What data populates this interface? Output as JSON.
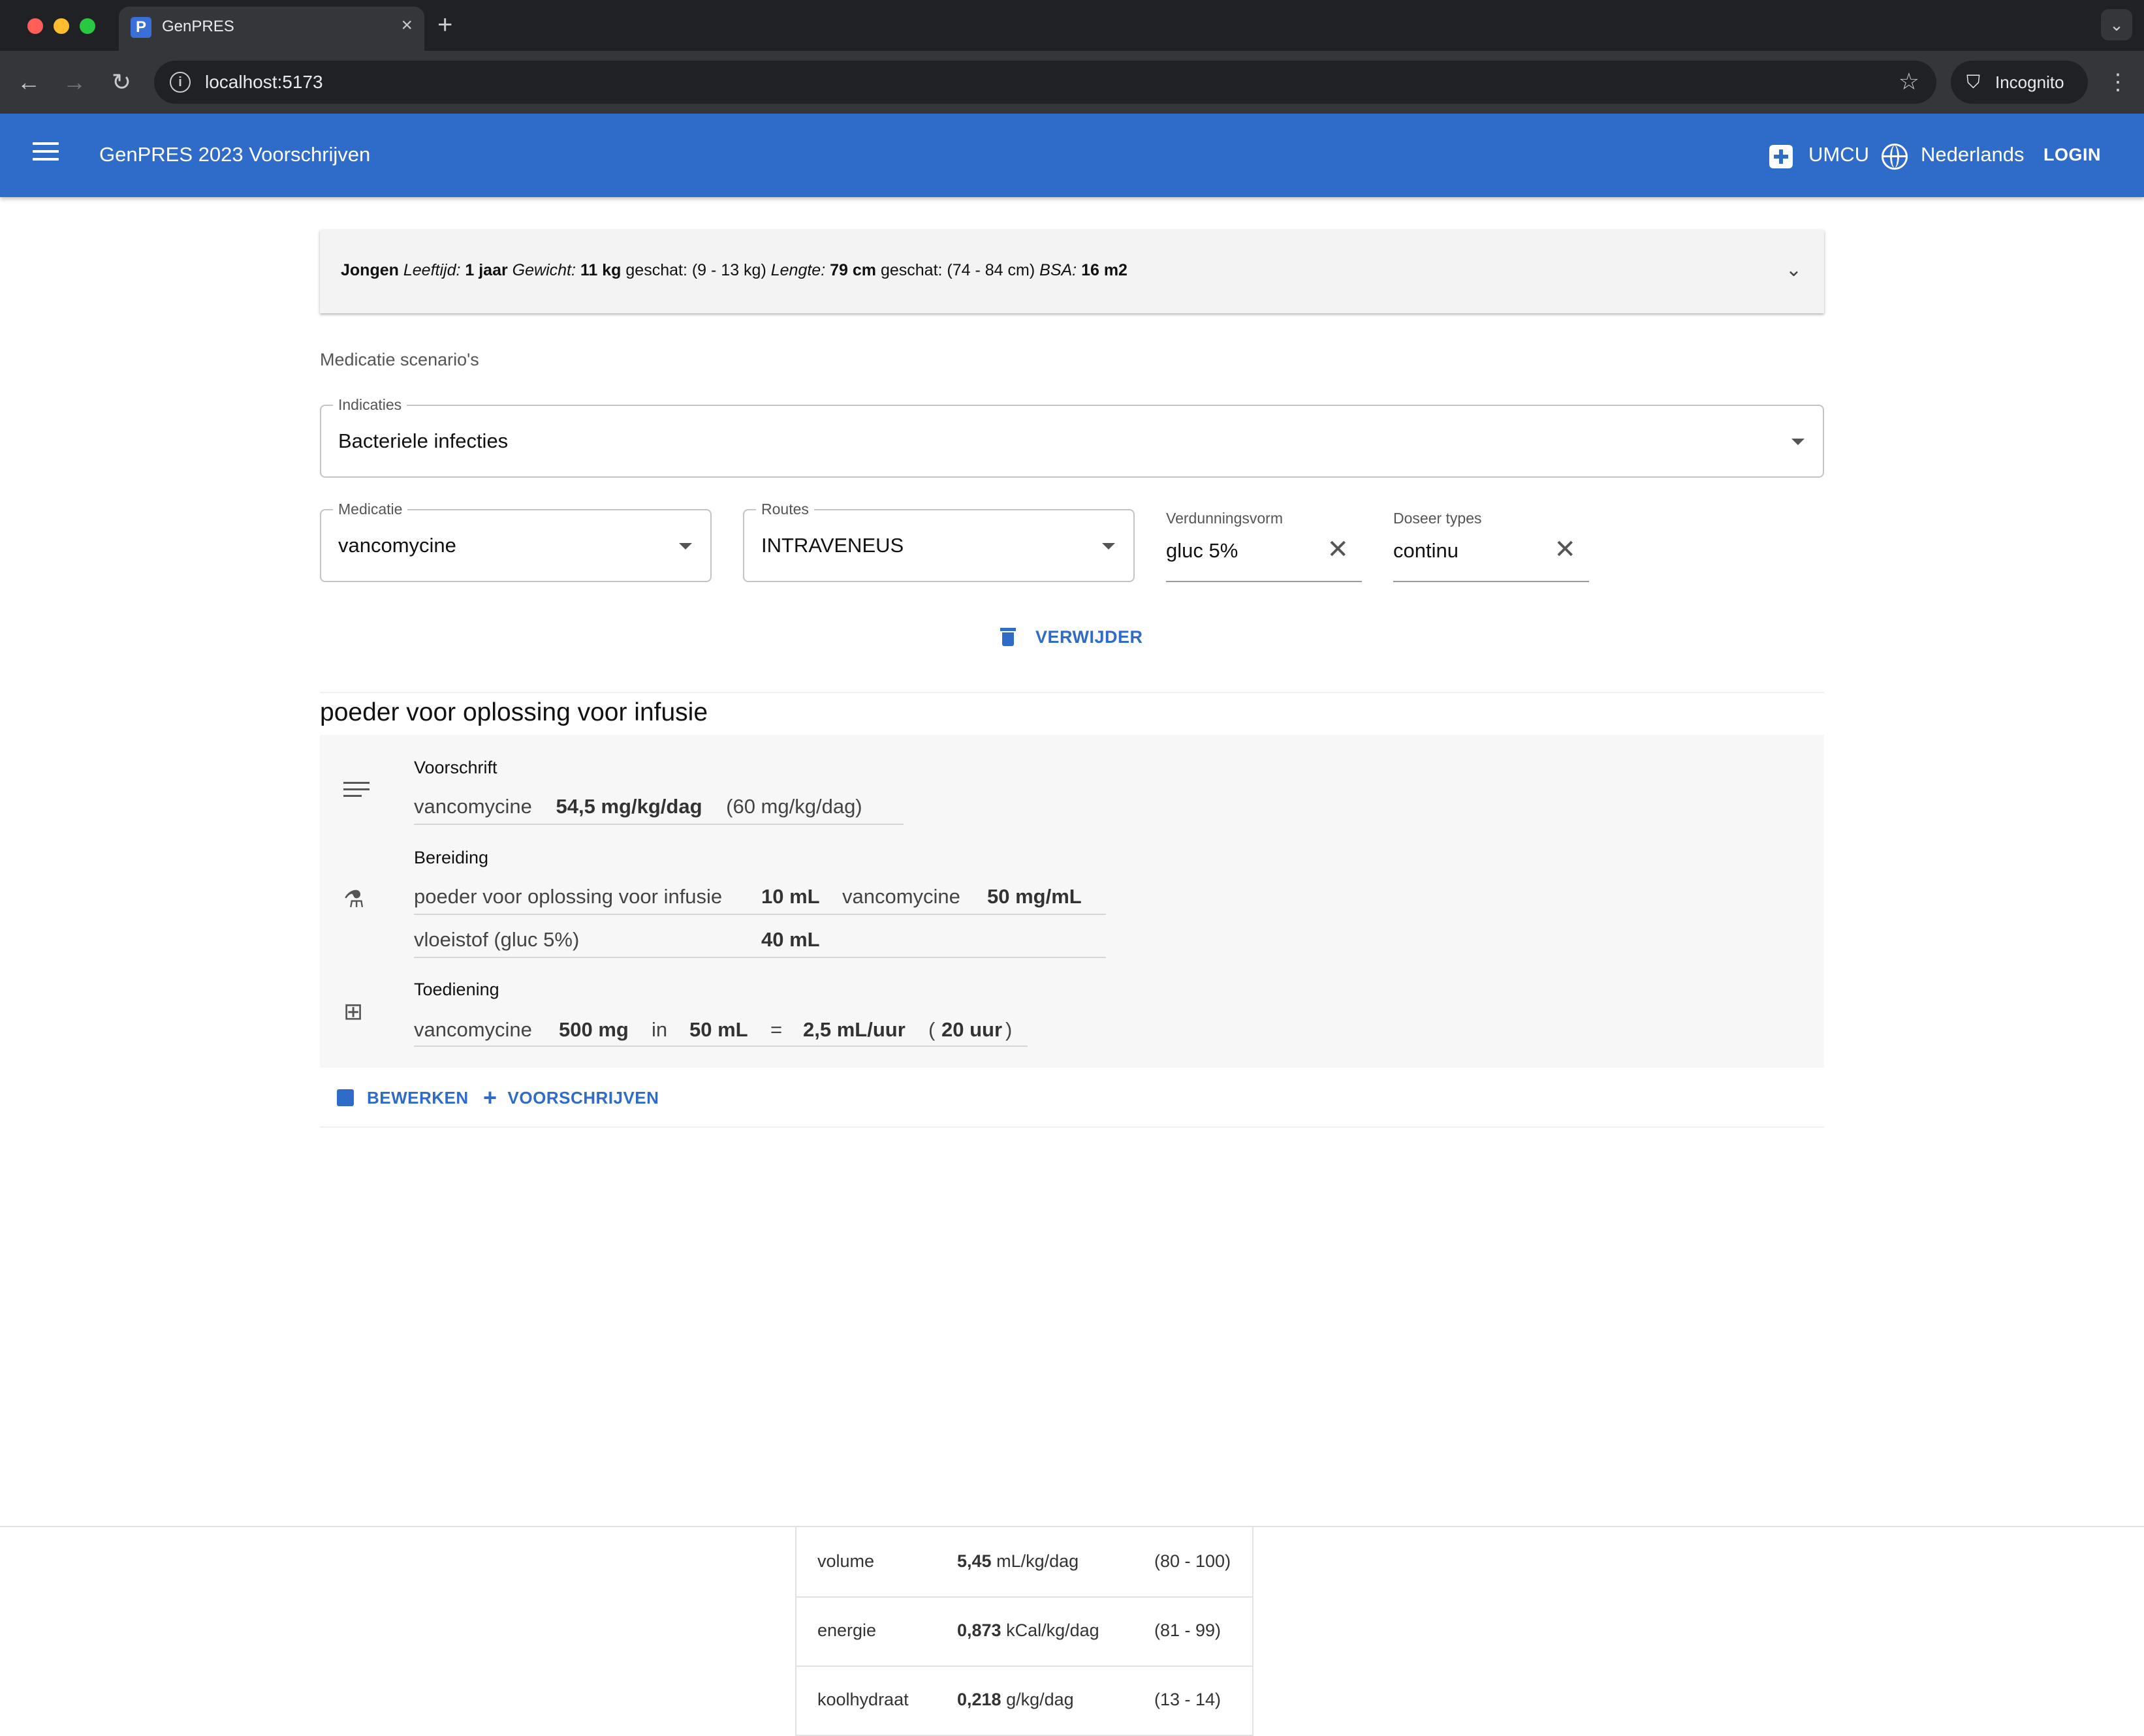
{
  "browser": {
    "tab_title": "GenPRES",
    "tab_favicon": "P",
    "new_tab": "+",
    "url": "localhost:5173",
    "incognito_label": "Incognito"
  },
  "appbar": {
    "title": "GenPRES 2023 Voorschrijven",
    "hospital": "UMCU",
    "language": "Nederlands",
    "login": "LOGIN",
    "color": "#2f6bc9"
  },
  "patient": {
    "gender": "Jongen",
    "age_label": "Leeftijd:",
    "age": "1 jaar",
    "weight_label": "Gewicht:",
    "weight": "11 kg",
    "weight_est": "geschat: (9 - 13 kg)",
    "length_label": "Lengte:",
    "length": "79 cm",
    "length_est": "geschat: (74 - 84 cm)",
    "bsa_label": "BSA:",
    "bsa": "16 m2"
  },
  "scenarios": {
    "heading": "Medicatie scenario's",
    "indication": {
      "label": "Indicaties",
      "value": "Bacteriele infecties"
    },
    "medication": {
      "label": "Medicatie",
      "value": "vancomycine"
    },
    "route": {
      "label": "Routes",
      "value": "INTRAVENEUS"
    },
    "dilution": {
      "label": "Verdunningsvorm",
      "value": "gluc 5%"
    },
    "dose_type": {
      "label": "Doseer types",
      "value": "continu"
    },
    "delete_label": "VERWIJDER"
  },
  "prescription": {
    "title": "poeder voor oplossing voor infusie",
    "voorschrift": {
      "heading": "Voorschrift",
      "drug": "vancomycine",
      "dose": "54,5 mg/kg/dag",
      "norm": "(60 mg/kg/dag)"
    },
    "bereiding": {
      "heading": "Bereiding",
      "component": "poeder voor oplossing voor infusie",
      "component_qty": "10 mL",
      "substance": "vancomycine",
      "conc": "50 mg/mL",
      "diluent": "vloeistof (gluc 5%)",
      "diluent_qty": "40 mL"
    },
    "toediening": {
      "heading": "Toediening",
      "drug": "vancomycine",
      "qty": "500 mg",
      "in": "in",
      "vol": "50 mL",
      "eq": "=",
      "rate": "2,5 mL/uur",
      "paren_open": "(",
      "time": "20 uur",
      "paren_close": ")"
    },
    "edit_label": "BEWERKEN",
    "prescribe_label": "VOORSCHRIJVEN"
  },
  "summary": [
    {
      "name": "volume",
      "value": "5,45",
      "unit": "mL/kg/dag",
      "range": "(80 - 100)"
    },
    {
      "name": "energie",
      "value": "0,873",
      "unit": "kCal/kg/dag",
      "range": "(81 - 99)"
    },
    {
      "name": "koolhydraat",
      "value": "0,218",
      "unit": "g/kg/dag",
      "range": "(13 - 14)"
    }
  ]
}
